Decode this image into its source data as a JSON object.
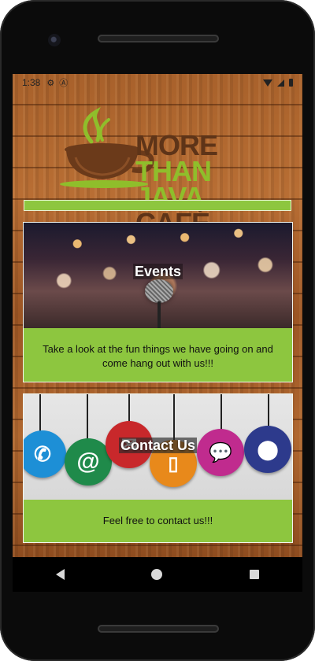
{
  "status_bar": {
    "time": "1:38",
    "icons": [
      "settings-icon",
      "a-icon",
      "wifi-icon",
      "signal-icon",
      "battery-icon"
    ]
  },
  "logo": {
    "line1_brown": "MORE ",
    "line1_green": "THAN",
    "line2_green": "JAVA ",
    "line2_brown": "CAFÉ",
    "colors": {
      "brown": "#5e3418",
      "green": "#8fbe2b"
    }
  },
  "cards": [
    {
      "title": "Events",
      "text": "Take a look at the fun things we have going on and come hang out with us!!!"
    },
    {
      "title": "Contact Us",
      "text": "Feel free to contact us!!!"
    }
  ],
  "contact_icons": [
    "phone-icon",
    "at-icon",
    "mail-icon",
    "mobile-icon",
    "chat-icon",
    "location-icon"
  ],
  "nav": {
    "icons": [
      "back-icon",
      "home-icon",
      "recents-icon"
    ]
  },
  "colors": {
    "card_green": "#8dc63f",
    "wood": "#a8612b"
  }
}
